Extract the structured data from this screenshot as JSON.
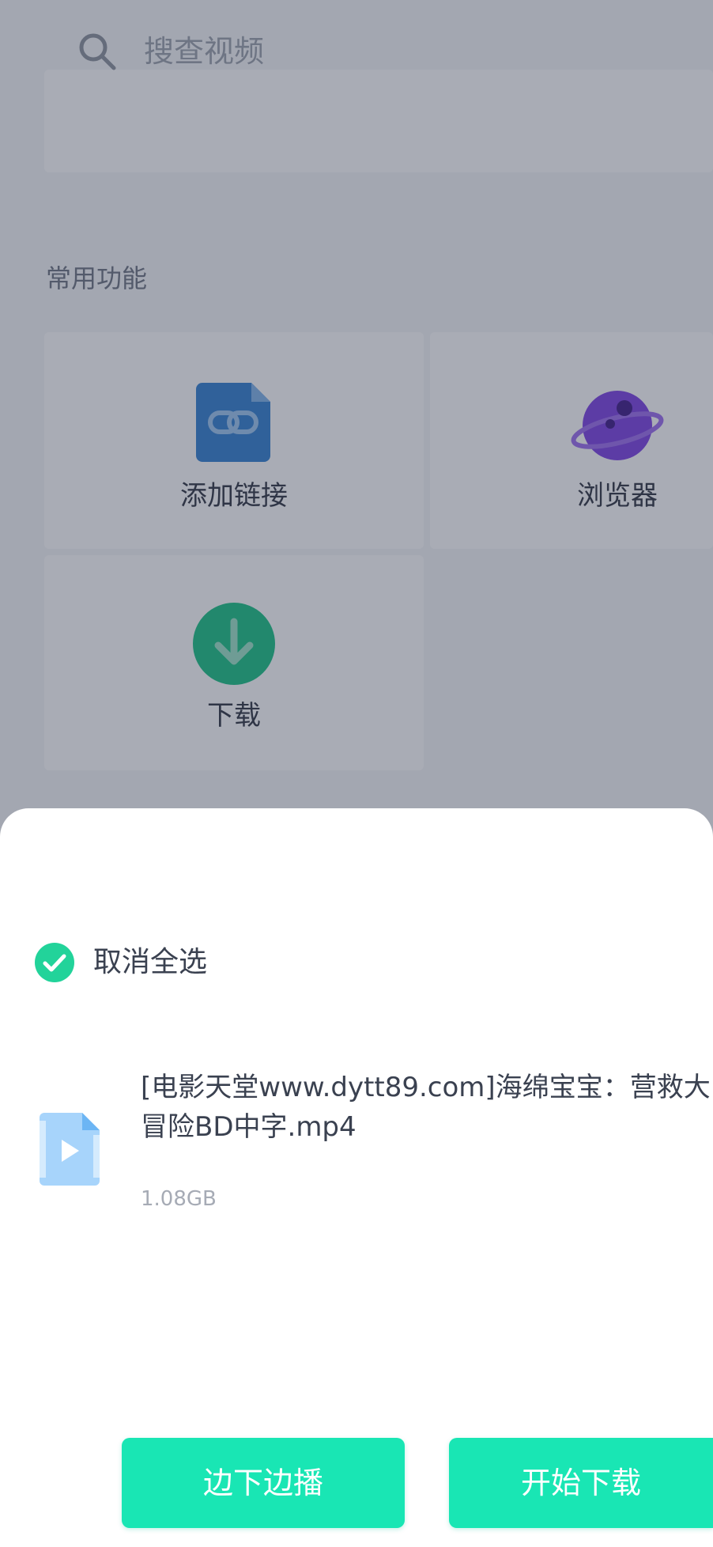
{
  "search": {
    "placeholder": "搜查视频"
  },
  "common_functions": {
    "title": "常用功能",
    "items": [
      {
        "label": "添加链接",
        "icon": "link-file-icon"
      },
      {
        "label": "浏览器",
        "icon": "planet-icon"
      },
      {
        "label": "下载",
        "icon": "download-icon"
      }
    ]
  },
  "sheet": {
    "select_all_label": "取消全选",
    "file": {
      "name": "[电影天堂www.dytt89.com]海绵宝宝：营救大\n冒险BD中字.mp4",
      "size": "1.08GB",
      "icon": "video-file-icon"
    },
    "buttons": {
      "play_while_download": "边下边播",
      "start_download": "开始下载"
    }
  },
  "colors": {
    "accent": "#19e6b4",
    "check": "#22d39a",
    "link_icon": "#2f7fd1",
    "planet_icon": "#7b3fe4",
    "download_icon": "#17c184",
    "overlay": "rgba(50,58,78,0.42)"
  }
}
